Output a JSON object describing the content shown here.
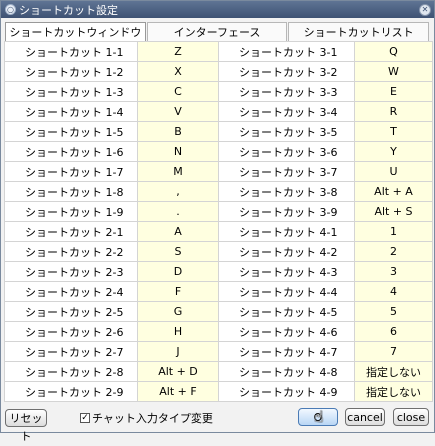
{
  "window": {
    "title": "ショートカット設定"
  },
  "tabs": [
    "ショートカットウィンドウ",
    "インターフェース",
    "ショートカットリスト"
  ],
  "rows": [
    {
      "l_name": "ショートカット 1-1",
      "l_key": "Z",
      "r_name": "ショートカット 3-1",
      "r_key": "Q"
    },
    {
      "l_name": "ショートカット 1-2",
      "l_key": "X",
      "r_name": "ショートカット 3-2",
      "r_key": "W"
    },
    {
      "l_name": "ショートカット 1-3",
      "l_key": "C",
      "r_name": "ショートカット 3-3",
      "r_key": "E"
    },
    {
      "l_name": "ショートカット 1-4",
      "l_key": "V",
      "r_name": "ショートカット 3-4",
      "r_key": "R"
    },
    {
      "l_name": "ショートカット 1-5",
      "l_key": "B",
      "r_name": "ショートカット 3-5",
      "r_key": "T"
    },
    {
      "l_name": "ショートカット 1-6",
      "l_key": "N",
      "r_name": "ショートカット 3-6",
      "r_key": "Y"
    },
    {
      "l_name": "ショートカット 1-7",
      "l_key": "M",
      "r_name": "ショートカット 3-7",
      "r_key": "U"
    },
    {
      "l_name": "ショートカット 1-8",
      "l_key": ",",
      "r_name": "ショートカット 3-8",
      "r_key": "Alt + A"
    },
    {
      "l_name": "ショートカット 1-9",
      "l_key": ".",
      "r_name": "ショートカット 3-9",
      "r_key": "Alt + S"
    },
    {
      "l_name": "ショートカット 2-1",
      "l_key": "A",
      "r_name": "ショートカット 4-1",
      "r_key": "1"
    },
    {
      "l_name": "ショートカット 2-2",
      "l_key": "S",
      "r_name": "ショートカット 4-2",
      "r_key": "2"
    },
    {
      "l_name": "ショートカット 2-3",
      "l_key": "D",
      "r_name": "ショートカット 4-3",
      "r_key": "3"
    },
    {
      "l_name": "ショートカット 2-4",
      "l_key": "F",
      "r_name": "ショートカット 4-4",
      "r_key": "4"
    },
    {
      "l_name": "ショートカット 2-5",
      "l_key": "G",
      "r_name": "ショートカット 4-5",
      "r_key": "5"
    },
    {
      "l_name": "ショートカット 2-6",
      "l_key": "H",
      "r_name": "ショートカット 4-6",
      "r_key": "6"
    },
    {
      "l_name": "ショートカット 2-7",
      "l_key": "J",
      "r_name": "ショートカット 4-7",
      "r_key": "7"
    },
    {
      "l_name": "ショートカット 2-8",
      "l_key": "Alt + D",
      "r_name": "ショートカット 4-8",
      "r_key": "指定しない"
    },
    {
      "l_name": "ショートカット 2-9",
      "l_key": "Alt + F",
      "r_name": "ショートカット 4-9",
      "r_key": "指定しない"
    }
  ],
  "buttons": {
    "reset": "リセット",
    "ok": "O",
    "cancel": "cancel",
    "close": "close"
  },
  "chat_type_change": {
    "label": "チャット入力タイプ変更",
    "checked": true
  }
}
